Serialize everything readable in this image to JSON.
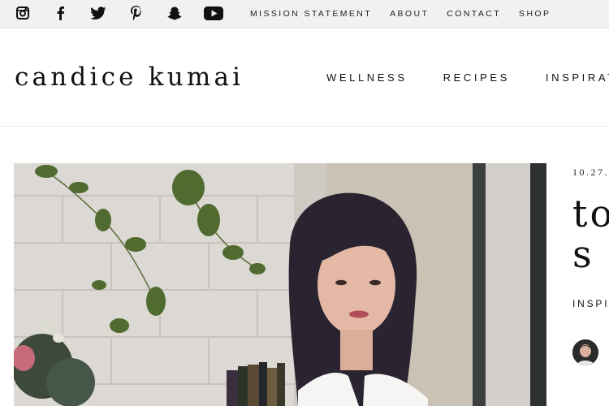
{
  "topbar": {
    "social_icons": [
      {
        "name": "instagram-icon"
      },
      {
        "name": "facebook-icon"
      },
      {
        "name": "twitter-icon"
      },
      {
        "name": "pinterest-icon"
      },
      {
        "name": "snapchat-icon"
      },
      {
        "name": "youtube-icon"
      }
    ],
    "links": [
      "MISSION STATEMENT",
      "ABOUT",
      "CONTACT",
      "SHOP"
    ]
  },
  "header": {
    "logo": "candice kumai",
    "nav": [
      "WELLNESS",
      "RECIPES",
      "INSPIRATI"
    ]
  },
  "post": {
    "date": "10.27.",
    "title": "to\ns l",
    "category": "INSPIR"
  },
  "colors": {
    "topbar_bg": "#f1f1f1",
    "text": "#111111",
    "hero_wall": "#d9d5d0"
  }
}
